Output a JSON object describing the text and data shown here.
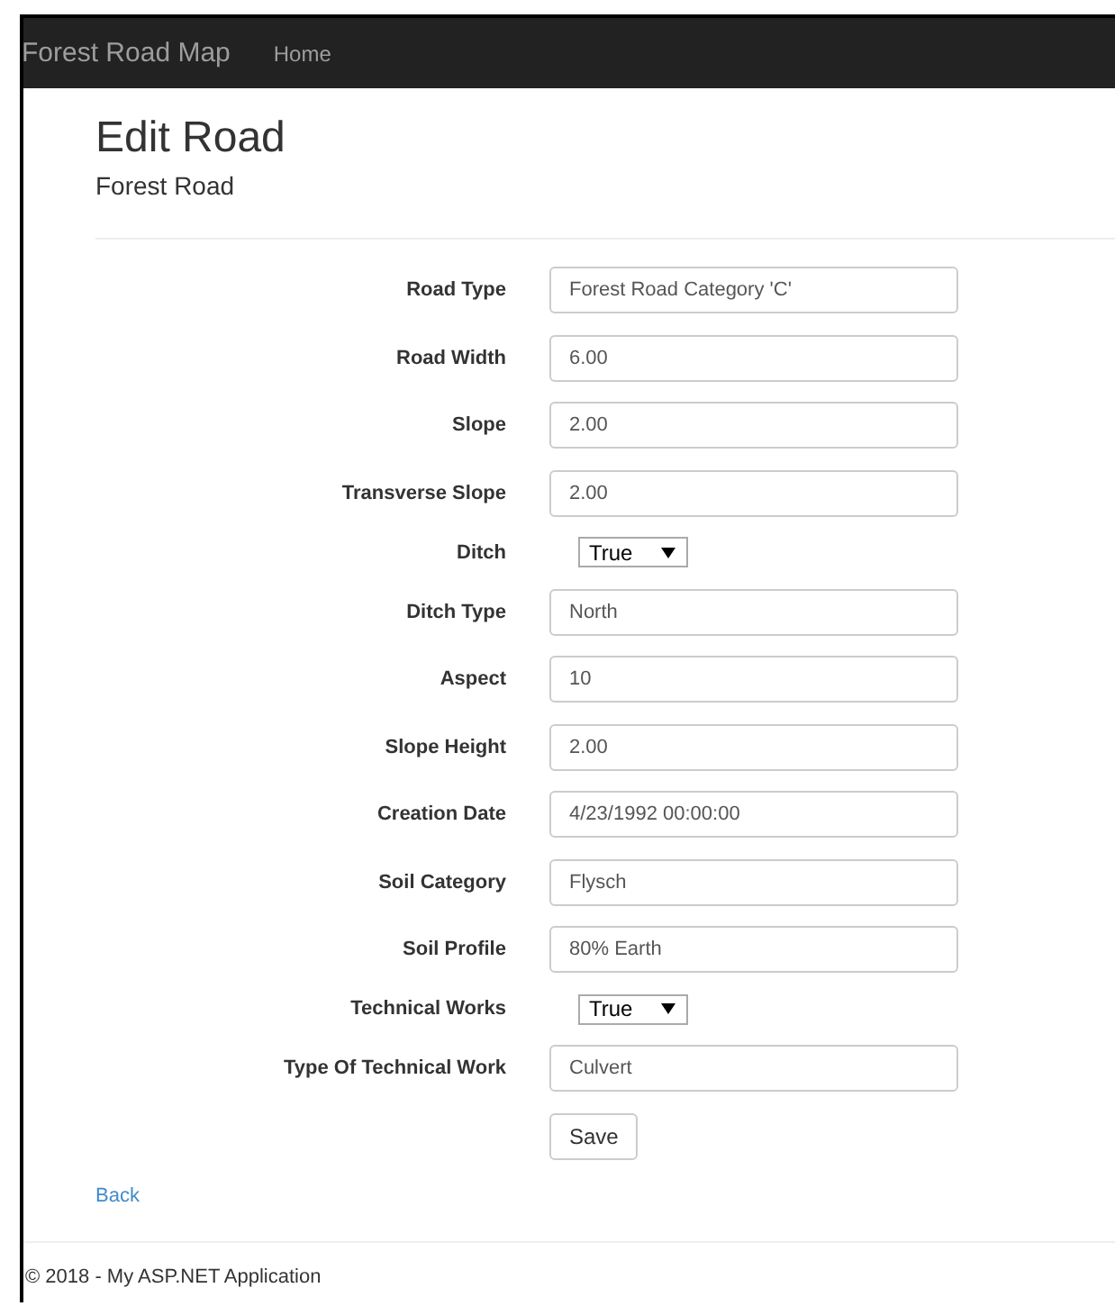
{
  "navbar": {
    "brand": "Forest Road Map",
    "links": [
      {
        "label": "Home"
      }
    ]
  },
  "heading": {
    "title": "Edit Road",
    "subtitle": "Forest Road"
  },
  "form": {
    "fields": [
      {
        "kind": "text",
        "label": "Road Type",
        "value": "Forest Road Category 'C'"
      },
      {
        "kind": "text",
        "label": "Road Width",
        "value": "6.00"
      },
      {
        "kind": "text",
        "label": "Slope",
        "value": "2.00"
      },
      {
        "kind": "text",
        "label": "Transverse Slope",
        "value": "2.00"
      },
      {
        "kind": "select",
        "label": "Ditch",
        "value": "True"
      },
      {
        "kind": "text",
        "label": "Ditch Type",
        "value": "North"
      },
      {
        "kind": "text",
        "label": "Aspect",
        "value": "10"
      },
      {
        "kind": "text",
        "label": "Slope Height",
        "value": "2.00"
      },
      {
        "kind": "text",
        "label": "Creation Date",
        "value": "4/23/1992 00:00:00"
      },
      {
        "kind": "text",
        "label": "Soil Category",
        "value": "Flysch"
      },
      {
        "kind": "text",
        "label": "Soil Profile",
        "value": "80% Earth"
      },
      {
        "kind": "select",
        "label": "Technical Works",
        "value": "True"
      },
      {
        "kind": "text",
        "label": "Type Of Technical Work",
        "value": "Culvert"
      }
    ],
    "submit": "Save"
  },
  "back_link": "Back",
  "footer": "© 2018 - My ASP.NET Application"
}
